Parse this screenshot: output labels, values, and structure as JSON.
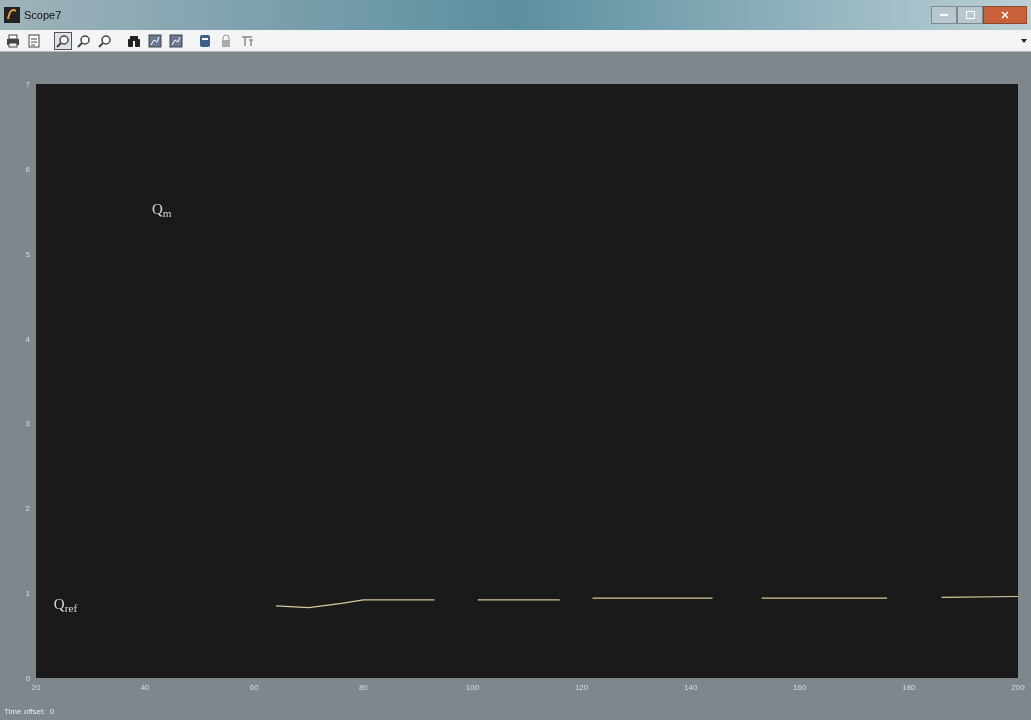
{
  "window": {
    "title": "Scope7"
  },
  "toolbar": [
    {
      "kind": "print",
      "selected": false
    },
    {
      "kind": "page",
      "selected": false
    },
    {
      "kind": "zoom",
      "selected": true
    },
    {
      "kind": "zoom-x",
      "selected": false
    },
    {
      "kind": "zoom-y",
      "selected": false
    },
    {
      "kind": "autoscale",
      "selected": false
    },
    {
      "kind": "save-axes",
      "selected": false
    },
    {
      "kind": "restore-axes",
      "selected": false
    },
    {
      "kind": "parameters",
      "selected": false
    },
    {
      "kind": "lock",
      "selected": false
    },
    {
      "kind": "float",
      "selected": false
    }
  ],
  "plot": {
    "chart_data": {
      "type": "line",
      "x": [
        64,
        70,
        76,
        80,
        93,
        101,
        116,
        122,
        144,
        153,
        176,
        186,
        200
      ],
      "series": [
        {
          "color": "#d8c89a",
          "values": [
            0.85,
            0.83,
            0.88,
            0.92,
            null,
            0.92,
            null,
            0.94,
            null,
            0.94,
            null,
            0.95,
            0.96
          ]
        }
      ],
      "xlim": [
        20,
        200
      ],
      "ylim": [
        0,
        7
      ],
      "xticks": [
        20,
        40,
        60,
        80,
        100,
        120,
        140,
        160,
        180,
        200
      ],
      "yticks": [
        0,
        1,
        2,
        3,
        4,
        5,
        6,
        7
      ],
      "annotations": [
        "Q$_{m}$",
        "Q$_{ref}$"
      ]
    }
  },
  "status_bar": {
    "text": "Time offset:  0"
  }
}
